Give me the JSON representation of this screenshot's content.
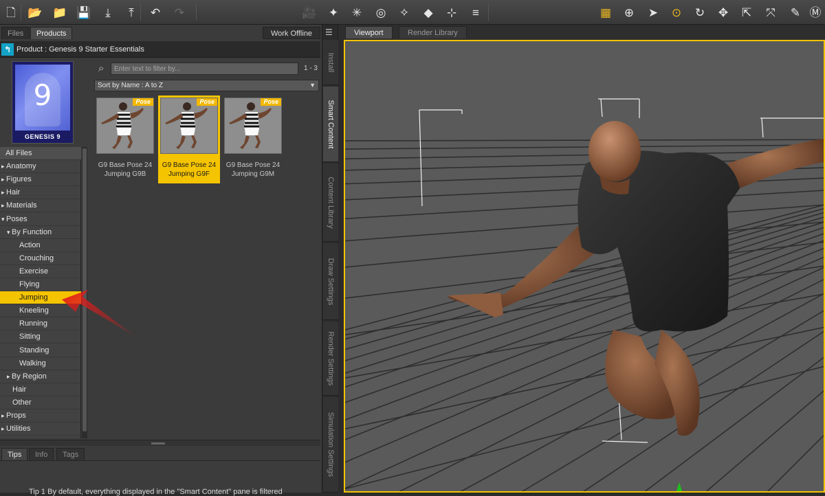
{
  "toolbar": {
    "icons": [
      "new-icon",
      "open-icon",
      "merge-icon",
      "save-icon",
      "import-icon",
      "export-icon",
      "undo-icon",
      "redo-icon",
      "scene-camera-icon",
      "light-icon",
      "spot-light-icon",
      "render-icon",
      "render-settings-icon",
      "node-icon",
      "figure-icon",
      "align-icon",
      "grid-icon",
      "world-navigator-icon",
      "pointer-icon",
      "active-pose-icon",
      "rotate-icon",
      "translate-icon",
      "scale-icon",
      "joint-editor-icon",
      "node-weight-icon",
      "geometry-editor-icon"
    ]
  },
  "left_panel": {
    "tabs": [
      "Files",
      "Products"
    ],
    "active_tab": "Products",
    "work_offline_label": "Work Offline",
    "breadcrumb": "Product : Genesis 9 Starter Essentials",
    "product_image": {
      "number": "9",
      "label": "GENESIS 9"
    },
    "filter": {
      "placeholder": "Enter text to filter by...",
      "count": "1 - 3"
    },
    "sort_label": "Sort by Name : A to Z",
    "categories": [
      {
        "label": "All Files",
        "indent": 0,
        "arrow": ""
      },
      {
        "label": "Anatomy",
        "indent": 0,
        "arrow": "▸"
      },
      {
        "label": "Figures",
        "indent": 0,
        "arrow": "▸"
      },
      {
        "label": "Hair",
        "indent": 0,
        "arrow": "▸"
      },
      {
        "label": "Materials",
        "indent": 0,
        "arrow": "▸"
      },
      {
        "label": "Poses",
        "indent": 0,
        "arrow": "▾"
      },
      {
        "label": "By Function",
        "indent": 1,
        "arrow": "▾"
      },
      {
        "label": "Action",
        "indent": 2,
        "arrow": ""
      },
      {
        "label": "Crouching",
        "indent": 2,
        "arrow": ""
      },
      {
        "label": "Exercise",
        "indent": 2,
        "arrow": ""
      },
      {
        "label": "Flying",
        "indent": 2,
        "arrow": ""
      },
      {
        "label": "Jumping",
        "indent": 2,
        "arrow": ""
      },
      {
        "label": "Kneeling",
        "indent": 2,
        "arrow": ""
      },
      {
        "label": "Running",
        "indent": 2,
        "arrow": ""
      },
      {
        "label": "Sitting",
        "indent": 2,
        "arrow": ""
      },
      {
        "label": "Standing",
        "indent": 2,
        "arrow": ""
      },
      {
        "label": "Walking",
        "indent": 2,
        "arrow": ""
      },
      {
        "label": "By Region",
        "indent": 1,
        "arrow": "▸"
      },
      {
        "label": "Hair",
        "indent": 1,
        "arrow": ""
      },
      {
        "label": "Other",
        "indent": 1,
        "arrow": ""
      },
      {
        "label": "Props",
        "indent": 0,
        "arrow": "▸"
      },
      {
        "label": "Utilities",
        "indent": 0,
        "arrow": "▸"
      }
    ],
    "selected_category": "Jumping",
    "items": [
      {
        "line1": "G9 Base Pose 24",
        "line2": "Jumping G9B",
        "tag": "Pose",
        "selected": false
      },
      {
        "line1": "G9 Base Pose 24",
        "line2": "Jumping G9F",
        "tag": "Pose",
        "selected": true
      },
      {
        "line1": "G9 Base Pose 24",
        "line2": "Jumping G9M",
        "tag": "Pose",
        "selected": false
      }
    ],
    "bottom_tabs": [
      "Tips",
      "Info",
      "Tags"
    ],
    "active_bottom_tab": "Tips",
    "tip_text": "Tip 1   By default, everything displayed in the \"Smart Content\" pane is filtered"
  },
  "vertical_tabs": [
    "Install",
    "Smart Content",
    "Content Library",
    "Draw Settings",
    "Render Settings",
    "Simulation Settings"
  ],
  "active_vertical_tab": "Smart Content",
  "viewport": {
    "tabs": [
      "Viewport",
      "Render Library"
    ],
    "active_tab": "Viewport"
  },
  "colors": {
    "accent": "#f5c400",
    "back_button": "#14a3c7",
    "annotation_arrow": "#e01b1b"
  }
}
